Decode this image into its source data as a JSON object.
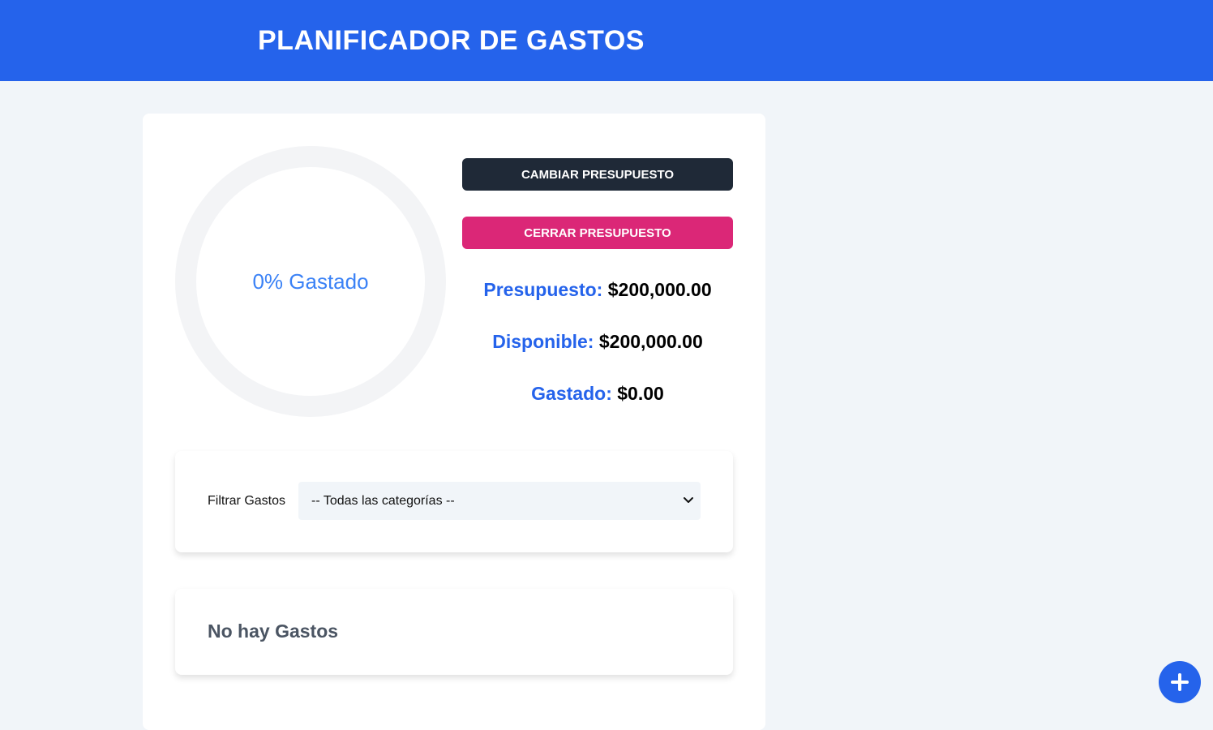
{
  "header": {
    "title": "PLANIFICADOR DE GASTOS"
  },
  "budget": {
    "percent_spent": 0,
    "percent_label": "0% Gastado",
    "change_button": "CAMBIAR PRESUPUESTO",
    "close_button": "CERRAR PRESUPUESTO",
    "stats": [
      {
        "label": "Presupuesto:",
        "value": "$200,000.00"
      },
      {
        "label": "Disponible:",
        "value": "$200,000.00"
      },
      {
        "label": "Gastado:",
        "value": "$0.00"
      }
    ]
  },
  "filter": {
    "label": "Filtrar Gastos",
    "selected": "-- Todas las categorías --"
  },
  "expenses": {
    "empty_title": "No hay Gastos"
  },
  "fab": {
    "icon": "plus-icon"
  },
  "colors": {
    "primary": "#2563eb",
    "dark_button": "#1f2937",
    "pink_button": "#db2777",
    "ring_track": "#f3f4f6",
    "ring_fill": "#3b82f6"
  }
}
